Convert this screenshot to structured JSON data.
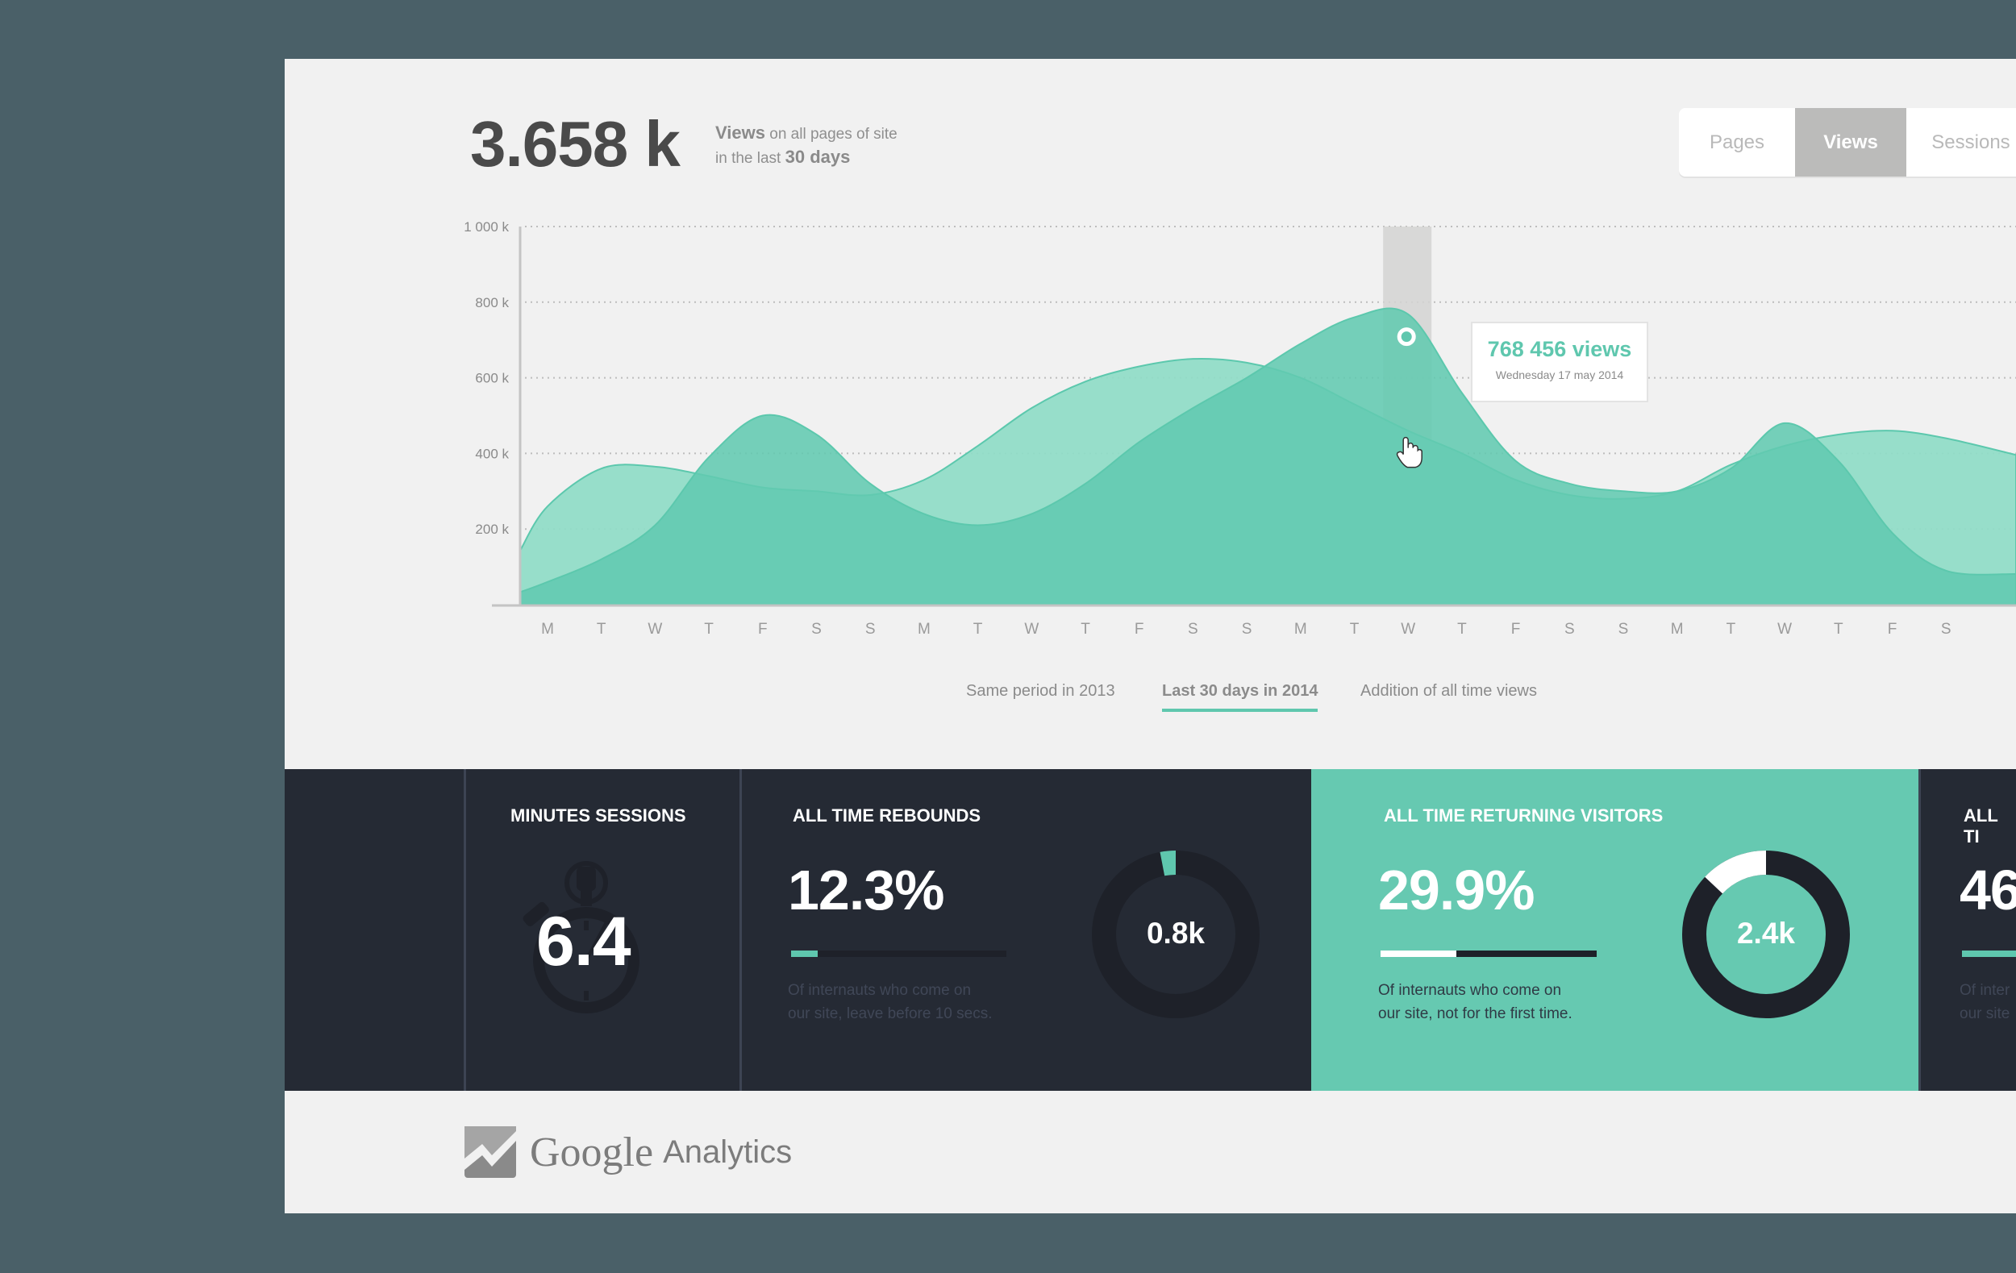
{
  "header": {
    "total_views": "3.658 k",
    "subtitle_line1_bold": "Views",
    "subtitle_line1_rest": " on all pages of site",
    "subtitle_line2_rest": "in the last ",
    "subtitle_line2_bold": "30 days"
  },
  "tabs": [
    {
      "label": "Pages",
      "active": false
    },
    {
      "label": "Views",
      "active": true
    },
    {
      "label": "Sessions",
      "active": false
    }
  ],
  "tooltip": {
    "value": "768 456 views",
    "date": "Wednesday 17 may 2014"
  },
  "legend": [
    {
      "label": "Same period in 2013",
      "active": false
    },
    {
      "label": "Last 30 days in 2014",
      "active": true
    },
    {
      "label": "Addition of all time views",
      "active": false
    }
  ],
  "chart_data": {
    "type": "area",
    "title": "",
    "xlabel": "",
    "ylabel": "",
    "categories": [
      "M",
      "T",
      "W",
      "T",
      "F",
      "S",
      "S",
      "M",
      "T",
      "W",
      "T",
      "F",
      "S",
      "S",
      "M",
      "T",
      "W",
      "T",
      "F",
      "S",
      "S",
      "M",
      "T",
      "W",
      "T",
      "F",
      "S"
    ],
    "yticks": [
      "200 k",
      "400 k",
      "600 k",
      "800 k",
      "1 000 k"
    ],
    "ytick_values": [
      200,
      400,
      600,
      800,
      1000
    ],
    "ylim": [
      0,
      1000
    ],
    "unit": "k views",
    "grid": true,
    "highlight_index": 16,
    "highlight_value": 768.456,
    "series": [
      {
        "name": "Same period in 2013",
        "color": "#8fdcc7",
        "values": [
          260,
          360,
          365,
          340,
          310,
          300,
          290,
          330,
          420,
          520,
          590,
          630,
          650,
          640,
          600,
          530,
          460,
          400,
          330,
          290,
          280,
          300,
          370,
          420,
          450,
          460,
          440
        ]
      },
      {
        "name": "Last 30 days in 2014",
        "color": "#62c9b0",
        "values": [
          60,
          120,
          210,
          390,
          500,
          450,
          320,
          240,
          210,
          240,
          320,
          430,
          520,
          600,
          690,
          760,
          768,
          560,
          380,
          320,
          300,
          300,
          360,
          480,
          380,
          190,
          90
        ]
      }
    ]
  },
  "stats": {
    "minutes_sessions": {
      "title": "MINUTES SESSIONS",
      "value": "6.4"
    },
    "rebounds": {
      "title": "ALL TIME REBOUNDS",
      "value": "12.3%",
      "progress": 0.123,
      "desc_line1": "Of internauts who come on",
      "desc_line2": "our site, leave before 10 secs.",
      "donut_label": "0.8k",
      "donut_fraction": 0.03
    },
    "returning": {
      "title": "ALL TIME RETURNING VISITORS",
      "value": "29.9%",
      "progress": 0.35,
      "desc_line1": "Of internauts who come on",
      "desc_line2": "our site, not for the first time.",
      "donut_label": "2.4k",
      "donut_fraction": 0.13
    },
    "partial": {
      "title": "ALL TI",
      "value": "46",
      "desc_line1": "Of inter",
      "desc_line2": "our site"
    }
  },
  "footer": {
    "logo_google": "Google",
    "logo_analytics": "Analytics"
  },
  "colors": {
    "accent": "#5fc7ae",
    "dark": "#252a34",
    "background": "#4a6068",
    "card": "#f1f1f1"
  }
}
